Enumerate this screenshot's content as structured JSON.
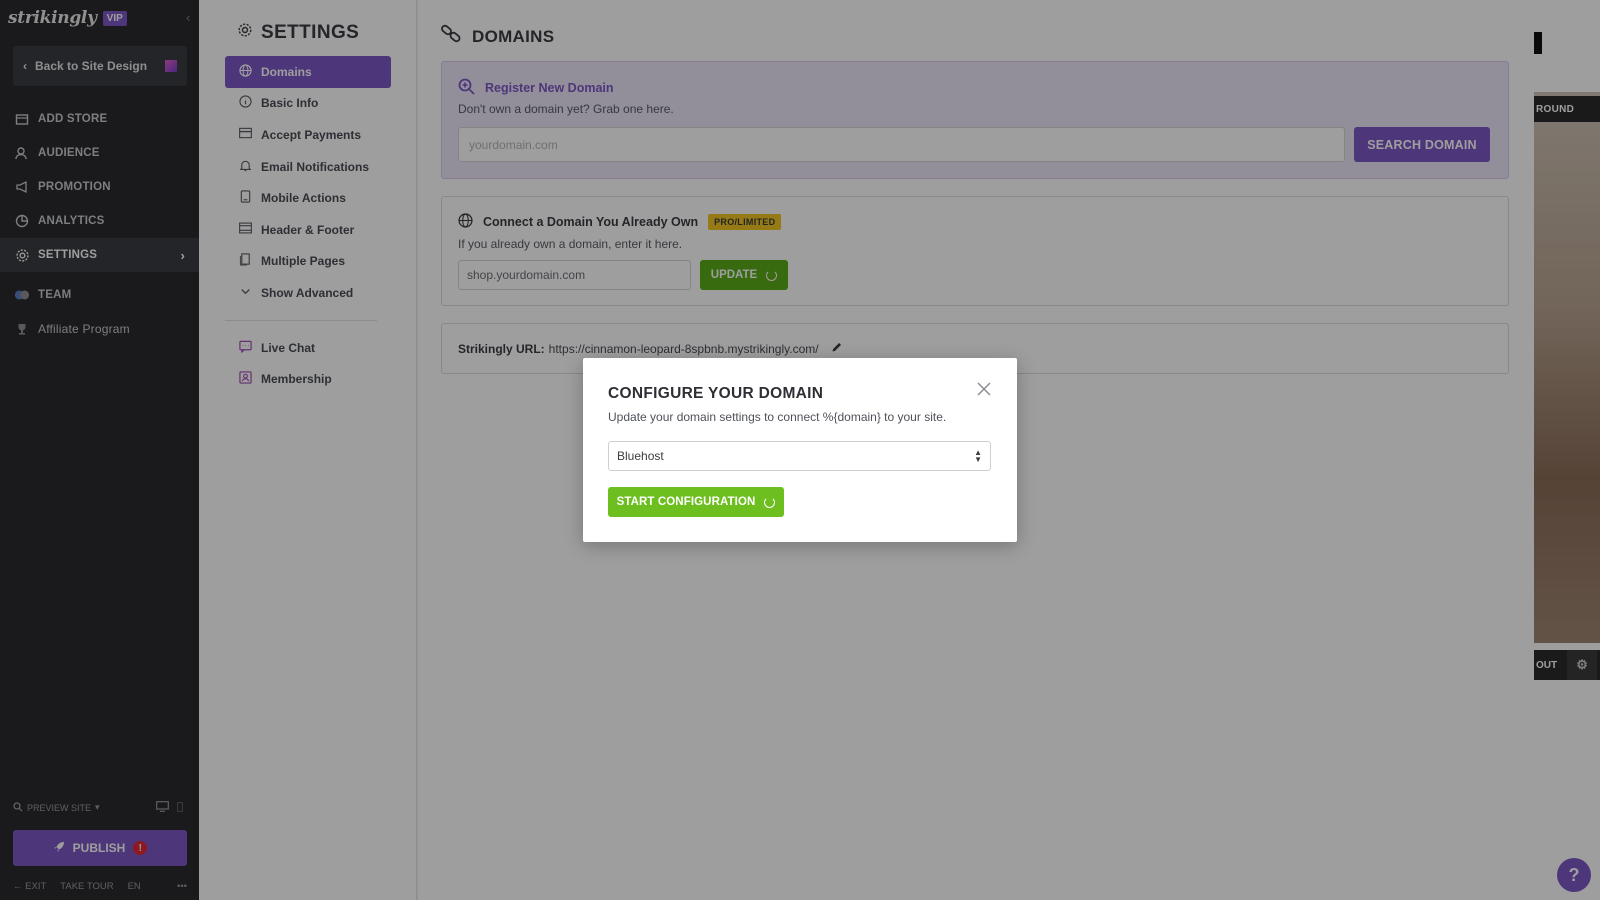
{
  "sidebar": {
    "logo": "strikingly",
    "vip_badge": "VIP",
    "back_button": "Back to Site Design",
    "nav": [
      {
        "label": "ADD STORE",
        "icon": "store-icon"
      },
      {
        "label": "AUDIENCE",
        "icon": "people-icon"
      },
      {
        "label": "PROMOTION",
        "icon": "megaphone-icon"
      },
      {
        "label": "ANALYTICS",
        "icon": "chart-icon"
      },
      {
        "label": "SETTINGS",
        "icon": "gear-icon"
      },
      {
        "label": "TEAM",
        "icon": "team-icon"
      },
      {
        "label": "Affiliate Program",
        "icon": "trophy-icon"
      }
    ],
    "preview_site": "PREVIEW SITE",
    "publish": "PUBLISH",
    "footer": {
      "exit": "EXIT",
      "tour": "TAKE TOUR",
      "lang": "EN",
      "more": "•••"
    }
  },
  "settings_menu": {
    "title": "SETTINGS",
    "items": [
      {
        "label": "Domains"
      },
      {
        "label": "Basic Info"
      },
      {
        "label": "Accept Payments"
      },
      {
        "label": "Email Notifications"
      },
      {
        "label": "Mobile Actions"
      },
      {
        "label": "Header & Footer"
      },
      {
        "label": "Multiple Pages"
      },
      {
        "label": "Show Advanced"
      }
    ],
    "extra": [
      {
        "label": "Live Chat"
      },
      {
        "label": "Membership"
      }
    ]
  },
  "main": {
    "title": "DOMAINS",
    "register": {
      "title": "Register New Domain",
      "subtitle": "Don't own a domain yet? Grab one here.",
      "placeholder": "yourdomain.com",
      "button": "SEARCH DOMAIN"
    },
    "connect": {
      "title": "Connect a Domain You Already Own",
      "badge": "PRO/LIMITED",
      "subtitle": "If you already own a domain, enter it here.",
      "value": "shop.yourdomain.com",
      "button": "UPDATE"
    },
    "strikingly_url": {
      "label": "Strikingly URL:",
      "value": "https://cinnamon-leopard-8spbnb.mystrikingly.com/"
    }
  },
  "preview": {
    "label_top": "ROUND",
    "label_bottom": "OUT",
    "help": "?"
  },
  "modal": {
    "title": "CONFIGURE YOUR DOMAIN",
    "subtitle": "Update your domain settings to connect %{domain} to your site.",
    "selected_provider": "Bluehost",
    "button": "START CONFIGURATION"
  },
  "colors": {
    "brand_purple": "#7d57c6",
    "green": "#6cbf1e",
    "badge_yellow": "#f3c522",
    "sidebar_bg": "#2a2a2e"
  }
}
